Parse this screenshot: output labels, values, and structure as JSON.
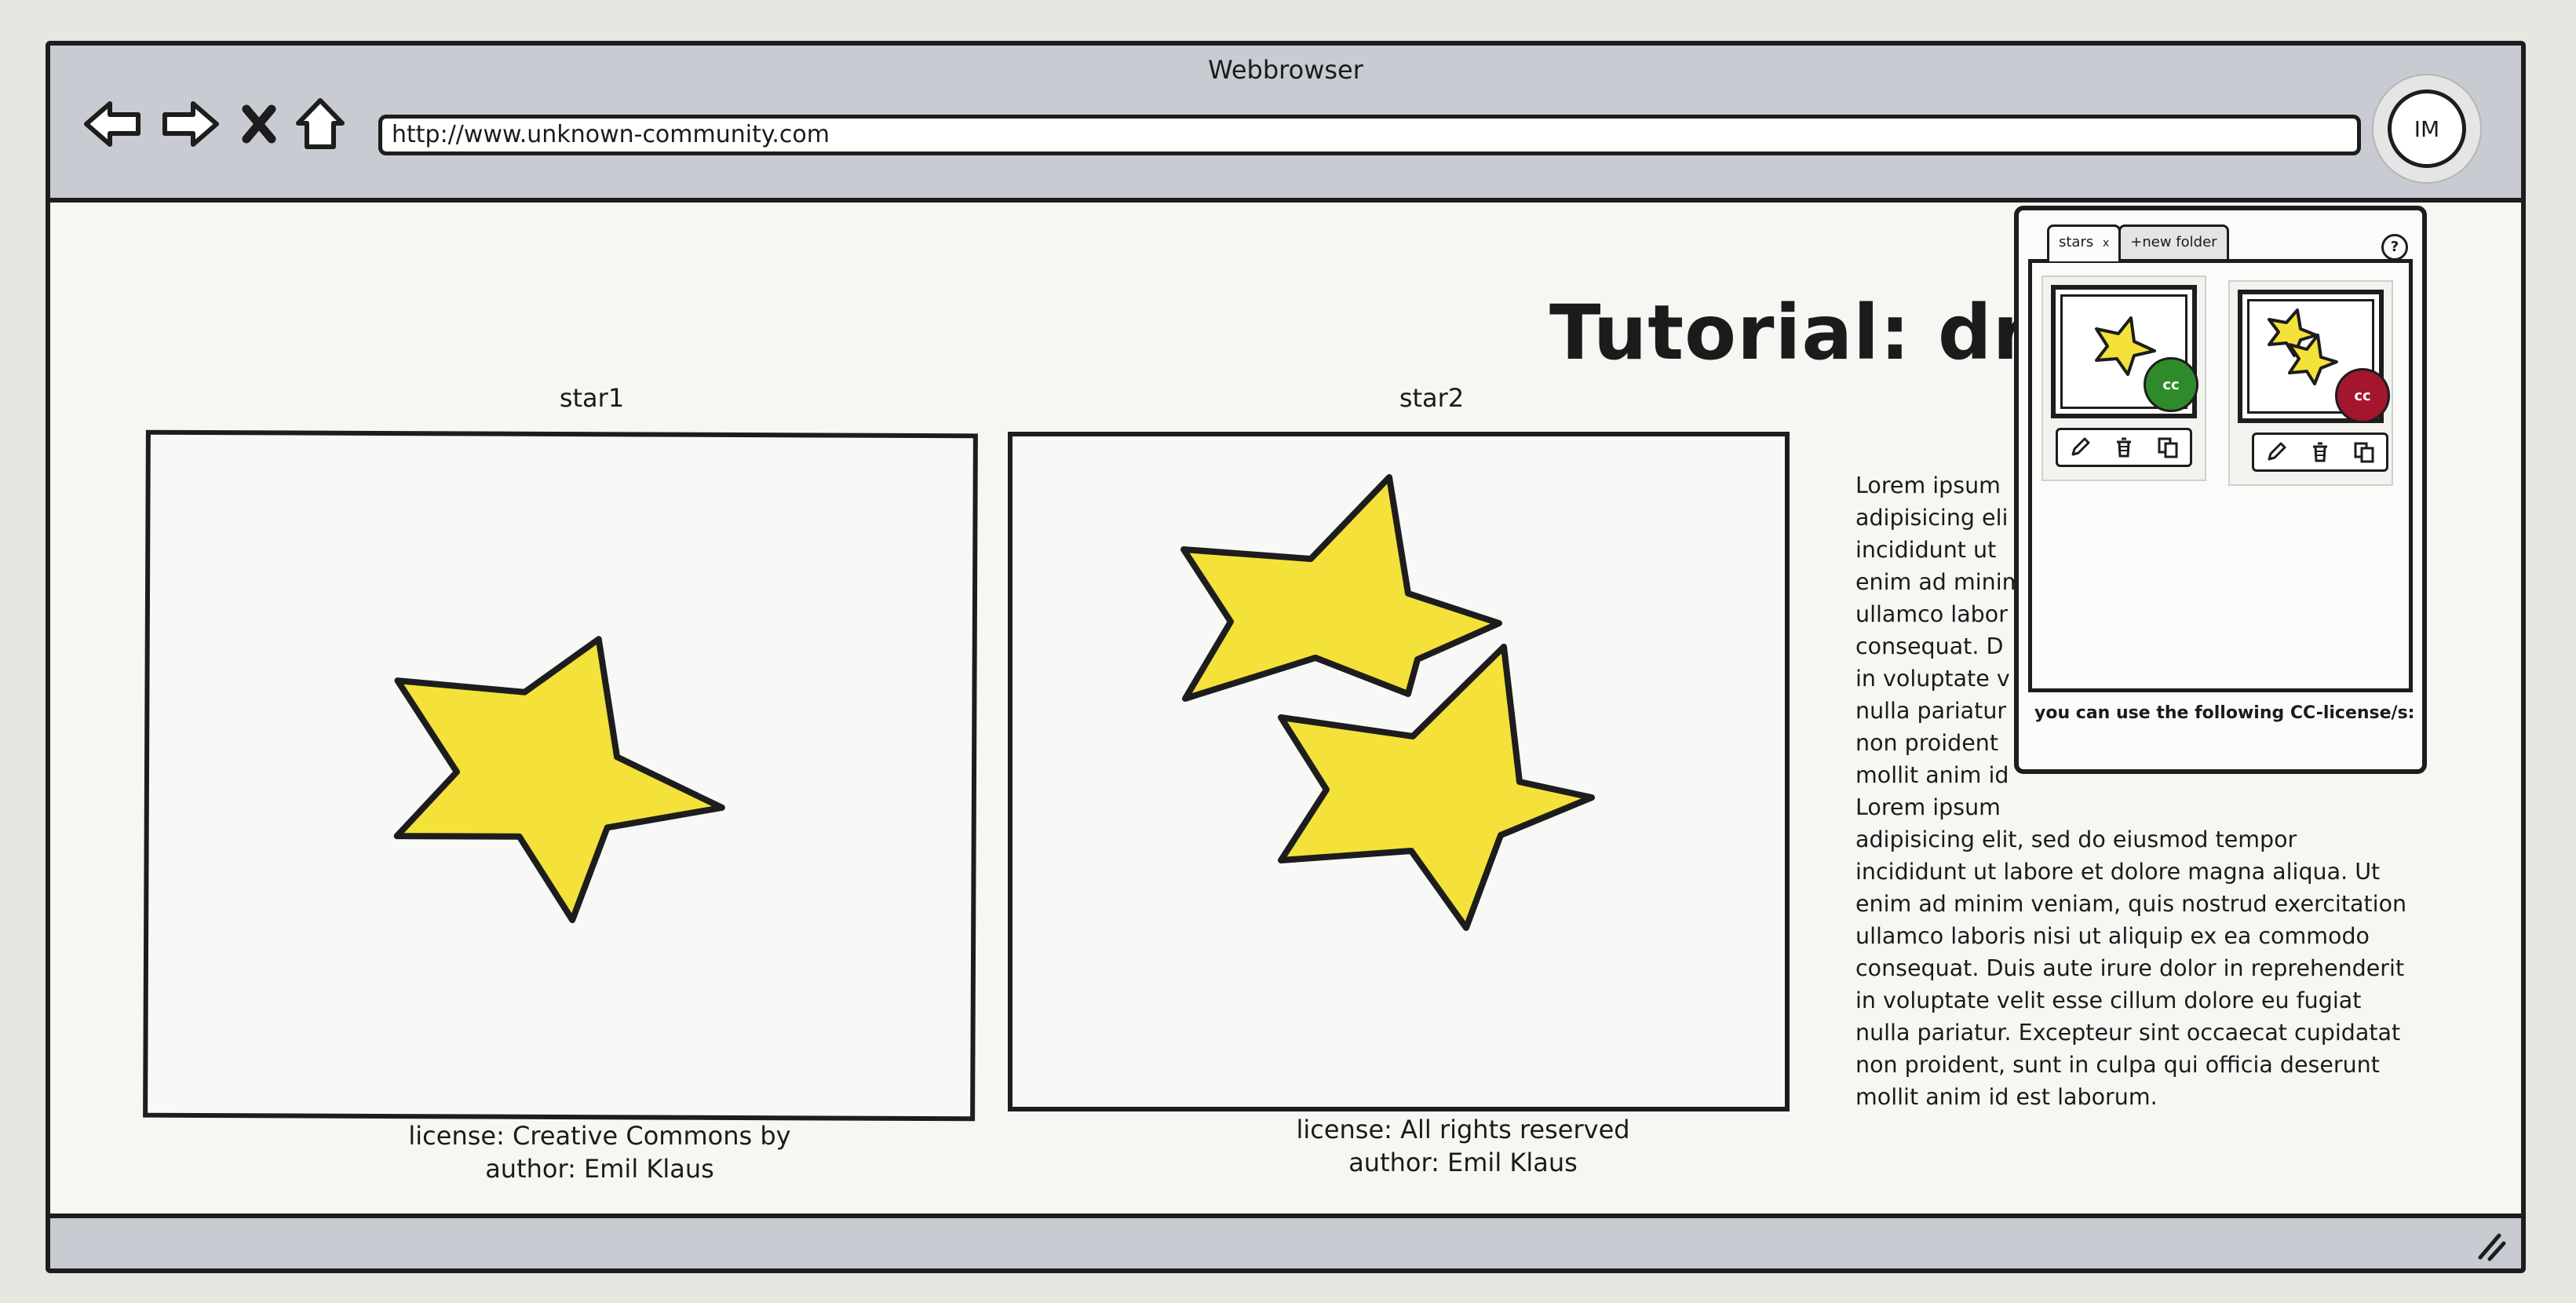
{
  "browser": {
    "title": "Webbrowser",
    "url": "http://www.unknown-community.com",
    "avatar_initials": "IM"
  },
  "page": {
    "title": "Tutorial: dra",
    "images": [
      {
        "caption": "star1",
        "license": "license: Creative Commons by",
        "author": "author: Emil Klaus"
      },
      {
        "caption": "star2",
        "license": "license: All rights reserved",
        "author": "author: Emil Klaus"
      }
    ],
    "lorem_lines": [
      "Lorem ipsum",
      "adipisicing eli",
      "incididunt ut",
      "enim ad minim",
      "ullamco labor",
      "consequat. D",
      "in voluptate v",
      "nulla pariatur",
      "non proident",
      "mollit anim id",
      "Lorem ipsum",
      "adipisicing elit, sed do eiusmod tempor",
      "incididunt ut labore et dolore magna aliqua. Ut",
      "enim ad minim veniam, quis nostrud exercitation",
      "ullamco laboris nisi ut aliquip ex ea commodo",
      "consequat. Duis aute irure dolor in reprehenderit",
      "in voluptate velit esse cillum dolore eu fugiat",
      "nulla pariatur. Excepteur sint occaecat cupidatat",
      "non proident, sunt in culpa qui officia deserunt",
      "mollit anim id est laborum."
    ]
  },
  "popup": {
    "tabs": [
      {
        "label": "stars",
        "close": "x"
      },
      {
        "label": "+new folder"
      }
    ],
    "help_label": "?",
    "items": [
      {
        "badge": "cc",
        "badge_color": "#2f8a2b"
      },
      {
        "badge": "cc",
        "badge_color": "#a4162d"
      }
    ],
    "footer": "you can use the following CC-license/s:"
  },
  "colors": {
    "chrome": "#c8cbd1",
    "star_fill": "#f4e13a",
    "outline": "#1d1d1d"
  },
  "icons": [
    "back-arrow-icon",
    "forward-arrow-icon",
    "stop-icon",
    "home-icon",
    "pencil-icon",
    "trash-icon",
    "copy-icon",
    "help-icon",
    "resize-grip-icon"
  ]
}
